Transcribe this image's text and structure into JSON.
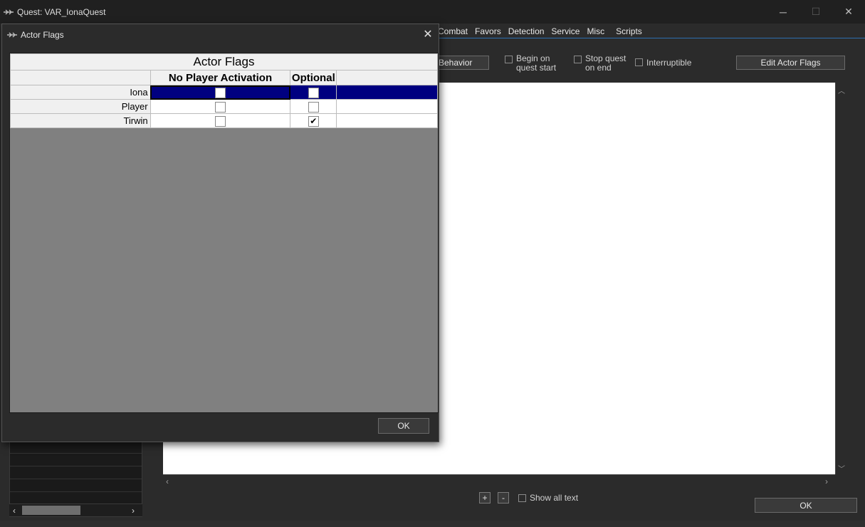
{
  "main_window": {
    "title": "Quest: VAR_IonaQuest",
    "controls": {
      "minimize": "─",
      "maximize": "☐",
      "close": "✕"
    },
    "tabs": [
      "Combat",
      "Favors",
      "Detection",
      "Service",
      "Misc",
      "Scripts"
    ],
    "behavior_button": "Behavior",
    "checkboxes": {
      "begin_on_quest_start": "Begin on quest start",
      "stop_quest_on_end": "Stop quest on end",
      "interruptible": "Interruptible"
    },
    "edit_actor_flags_button": "Edit Actor Flags",
    "plus_button": "+",
    "minus_button": "-",
    "show_all_text": "Show all text",
    "ok_button": "OK"
  },
  "dialog": {
    "title": "Actor Flags",
    "close_icon": "✕",
    "grid": {
      "title": "Actor Flags",
      "columns": [
        "No Player Activation",
        "Optional"
      ],
      "rows": [
        {
          "name": "Iona",
          "no_player_activation": false,
          "optional": false,
          "selected": true
        },
        {
          "name": "Player",
          "no_player_activation": false,
          "optional": false,
          "selected": false
        },
        {
          "name": "Tirwin",
          "no_player_activation": false,
          "optional": true,
          "selected": false
        }
      ]
    },
    "ok_button": "OK"
  }
}
